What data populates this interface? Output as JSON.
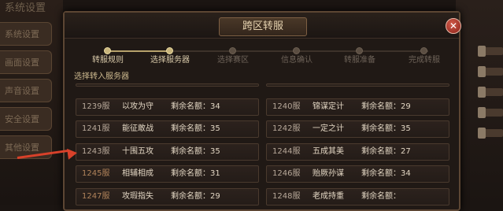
{
  "background": {
    "title": "系统设置",
    "tabs": [
      "系统设置",
      "画面设置",
      "声音设置",
      "安全设置",
      "其他设置"
    ],
    "sliders": [
      "100",
      "100",
      "100",
      "100",
      "100",
      "100"
    ]
  },
  "dialog": {
    "title": "跨区转服",
    "close_icon": "close-icon"
  },
  "steps": [
    {
      "label": "转服规则",
      "done": true
    },
    {
      "label": "选择服务器",
      "done": true
    },
    {
      "label": "选择赛区",
      "done": false
    },
    {
      "label": "信息确认",
      "done": false
    },
    {
      "label": "转服准备",
      "done": false
    },
    {
      "label": "完成转服",
      "done": false
    }
  ],
  "subtitle": "选择转入服务器",
  "servers": [
    {
      "id": "1239服",
      "name": "以攻为守",
      "remaining": "剩余名额：34"
    },
    {
      "id": "1240服",
      "name": "锦谋定计",
      "remaining": "剩余名额：29"
    },
    {
      "id": "1241服",
      "name": "能征敢战",
      "remaining": "剩余名额：35"
    },
    {
      "id": "1242服",
      "name": "一定之计",
      "remaining": "剩余名额：35"
    },
    {
      "id": "1243服",
      "name": "十围五攻",
      "remaining": "剩余名额：35"
    },
    {
      "id": "1244服",
      "name": "五成其美",
      "remaining": "剩余名额：27"
    },
    {
      "id": "1245服",
      "name": "相辅相成",
      "remaining": "剩余名额：31"
    },
    {
      "id": "1246服",
      "name": "贻厥孙谋",
      "remaining": "剩余名额：34"
    },
    {
      "id": "1247服",
      "name": "攻瑕指失",
      "remaining": "剩余名额：29"
    },
    {
      "id": "1248服",
      "name": "老成持重",
      "remaining": "剩余名额："
    }
  ],
  "colors": {
    "accent": "#c9b57c",
    "arrow": "#d8412a",
    "close": "#b8362a"
  }
}
